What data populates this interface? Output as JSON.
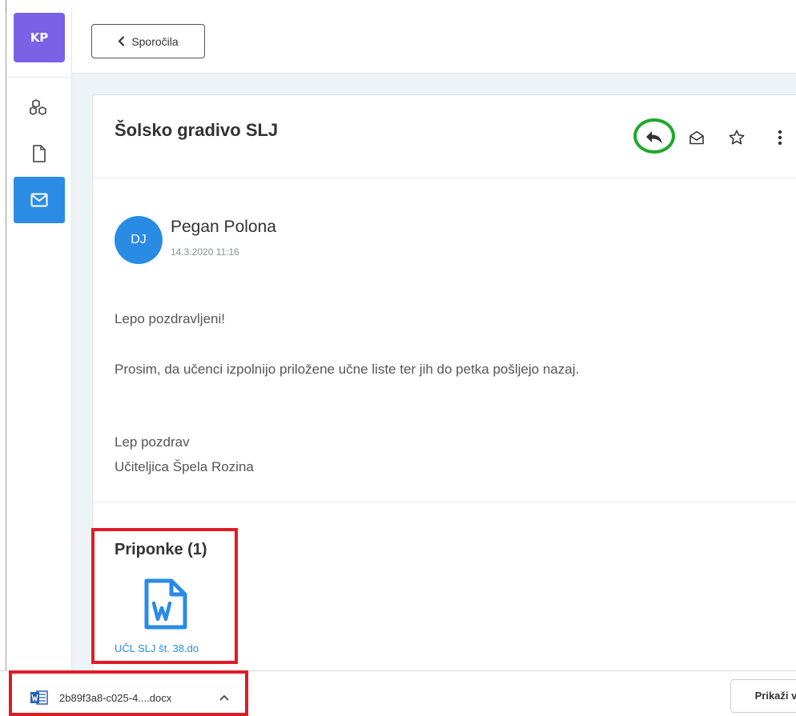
{
  "sidebar": {
    "user_initials": "KP",
    "items": [
      {
        "icon": "boxes-icon"
      },
      {
        "icon": "document-icon"
      },
      {
        "icon": "mail-icon",
        "active": true
      }
    ]
  },
  "header": {
    "back_label": "Sporočila"
  },
  "message": {
    "subject": "Šolsko gradivo SLJ",
    "actions": [
      "reply-icon",
      "mark-read-icon",
      "star-icon",
      "more-icon"
    ],
    "sender": {
      "initials": "DJ",
      "name": "Pegan Polona",
      "date": "14.3.2020 11:16"
    },
    "body": {
      "greeting": "Lepo pozdravljeni!",
      "paragraph": "Prosim, da učenci izpolnijo priložene učne liste ter jih do petka pošljejo nazaj.",
      "closing_1": "Lep pozdrav",
      "closing_2": "Učiteljica Špela Rozina"
    },
    "attachments": {
      "title": "Priponke (1)",
      "items": [
        {
          "name": "UČL SLJ št. 38.do",
          "icon": "word-doc-icon"
        }
      ]
    }
  },
  "download_bar": {
    "file_name": "2b89f3a8-c025-4....docx",
    "show_all_label": "Prikaži v"
  },
  "colors": {
    "accent": "#2b8ce6",
    "avatar_purple": "#7b61e6",
    "highlight_green": "#1fa82d",
    "highlight_red": "#e01b24"
  }
}
